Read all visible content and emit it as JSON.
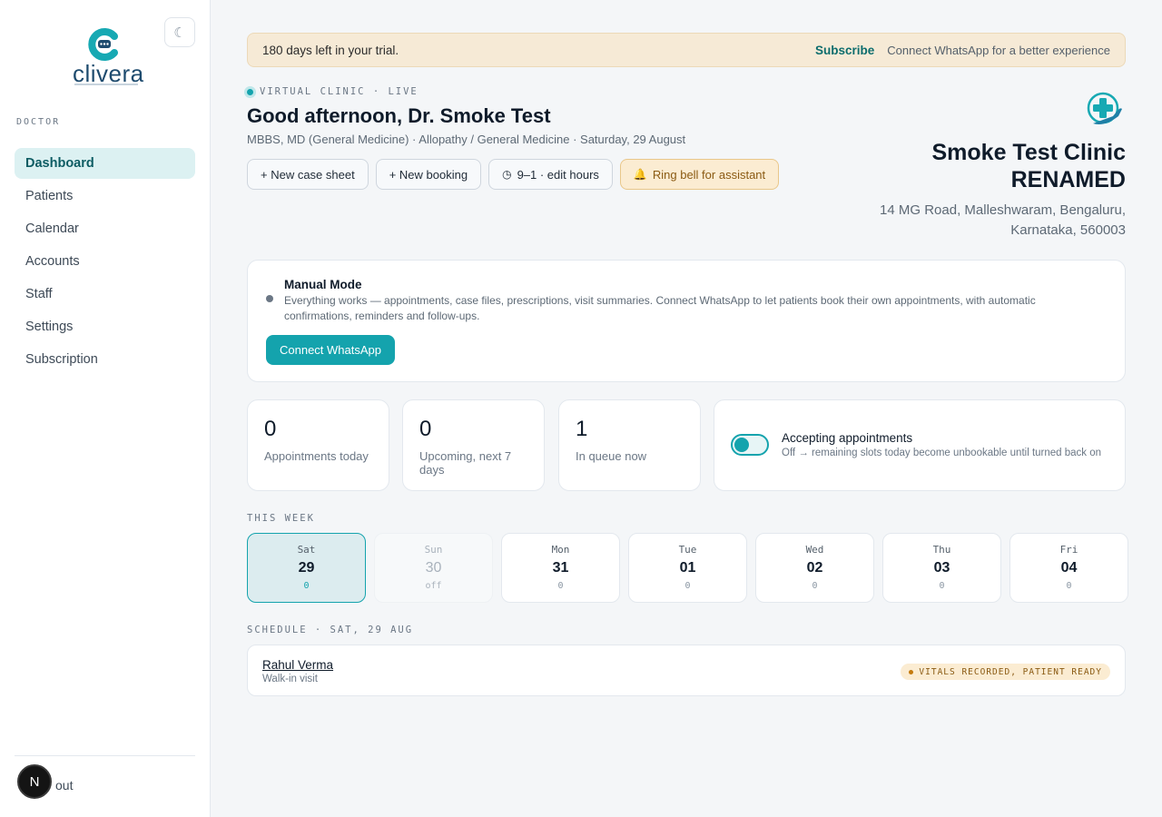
{
  "sidebar": {
    "theme_icon": "moon-icon",
    "logo_text": "clivera",
    "role": "DOCTOR",
    "items": [
      {
        "label": "Dashboard",
        "active": true
      },
      {
        "label": "Patients"
      },
      {
        "label": "Calendar"
      },
      {
        "label": "Accounts"
      },
      {
        "label": "Staff"
      },
      {
        "label": "Settings"
      },
      {
        "label": "Subscription"
      }
    ],
    "avatar_letter": "N",
    "signout_label": "out"
  },
  "trial": {
    "text": "180 days left in your trial.",
    "subscribe": "Subscribe",
    "whatsapp": "Connect WhatsApp for a better experience"
  },
  "header": {
    "live": "VIRTUAL CLINIC · LIVE",
    "greeting": "Good afternoon, Dr. Smoke Test",
    "subline": "MBBS, MD (General Medicine) · Allopathy / General Medicine · Saturday, 29 August",
    "actions": {
      "new_case": "+ New case sheet",
      "new_booking": "+ New booking",
      "hours": "9–1 · edit hours",
      "bell": "Ring bell for assistant"
    }
  },
  "clinic": {
    "name_line1": "Smoke Test Clinic",
    "name_line2": "RENAMED",
    "addr_line1": "14 MG Road, Malleshwaram, Bengaluru,",
    "addr_line2": "Karnataka, 560003"
  },
  "manual": {
    "title": "Manual Mode",
    "desc": "Everything works — appointments, case files, prescriptions, visit summaries. Connect WhatsApp to let patients book their own appointments, with automatic confirmations, reminders and follow-ups.",
    "button": "Connect WhatsApp"
  },
  "stats": [
    {
      "value": "0",
      "label": "Appointments today"
    },
    {
      "value": "0",
      "label": "Upcoming, next 7 days"
    },
    {
      "value": "1",
      "label": "In queue now"
    }
  ],
  "accepting": {
    "enabled": true,
    "title": "Accepting appointments",
    "sub": "Off → remaining slots today become unbookable until turned back on"
  },
  "week": {
    "label": "THIS WEEK",
    "days": [
      {
        "name": "Sat",
        "num": "29",
        "count": "0",
        "state": "active"
      },
      {
        "name": "Sun",
        "num": "30",
        "count": "off",
        "state": "off"
      },
      {
        "name": "Mon",
        "num": "31",
        "count": "0"
      },
      {
        "name": "Tue",
        "num": "01",
        "count": "0"
      },
      {
        "name": "Wed",
        "num": "02",
        "count": "0"
      },
      {
        "name": "Thu",
        "num": "03",
        "count": "0"
      },
      {
        "name": "Fri",
        "num": "04",
        "count": "0"
      }
    ]
  },
  "schedule": {
    "label": "SCHEDULE · SAT, 29 AUG",
    "items": [
      {
        "name": "Rahul Verma",
        "type": "Walk-in visit",
        "status": "VITALS RECORDED, PATIENT READY"
      }
    ]
  },
  "colors": {
    "accent": "#14a3ad",
    "accent_dark": "#0d5c63",
    "warn_bg": "#fbecd2"
  }
}
